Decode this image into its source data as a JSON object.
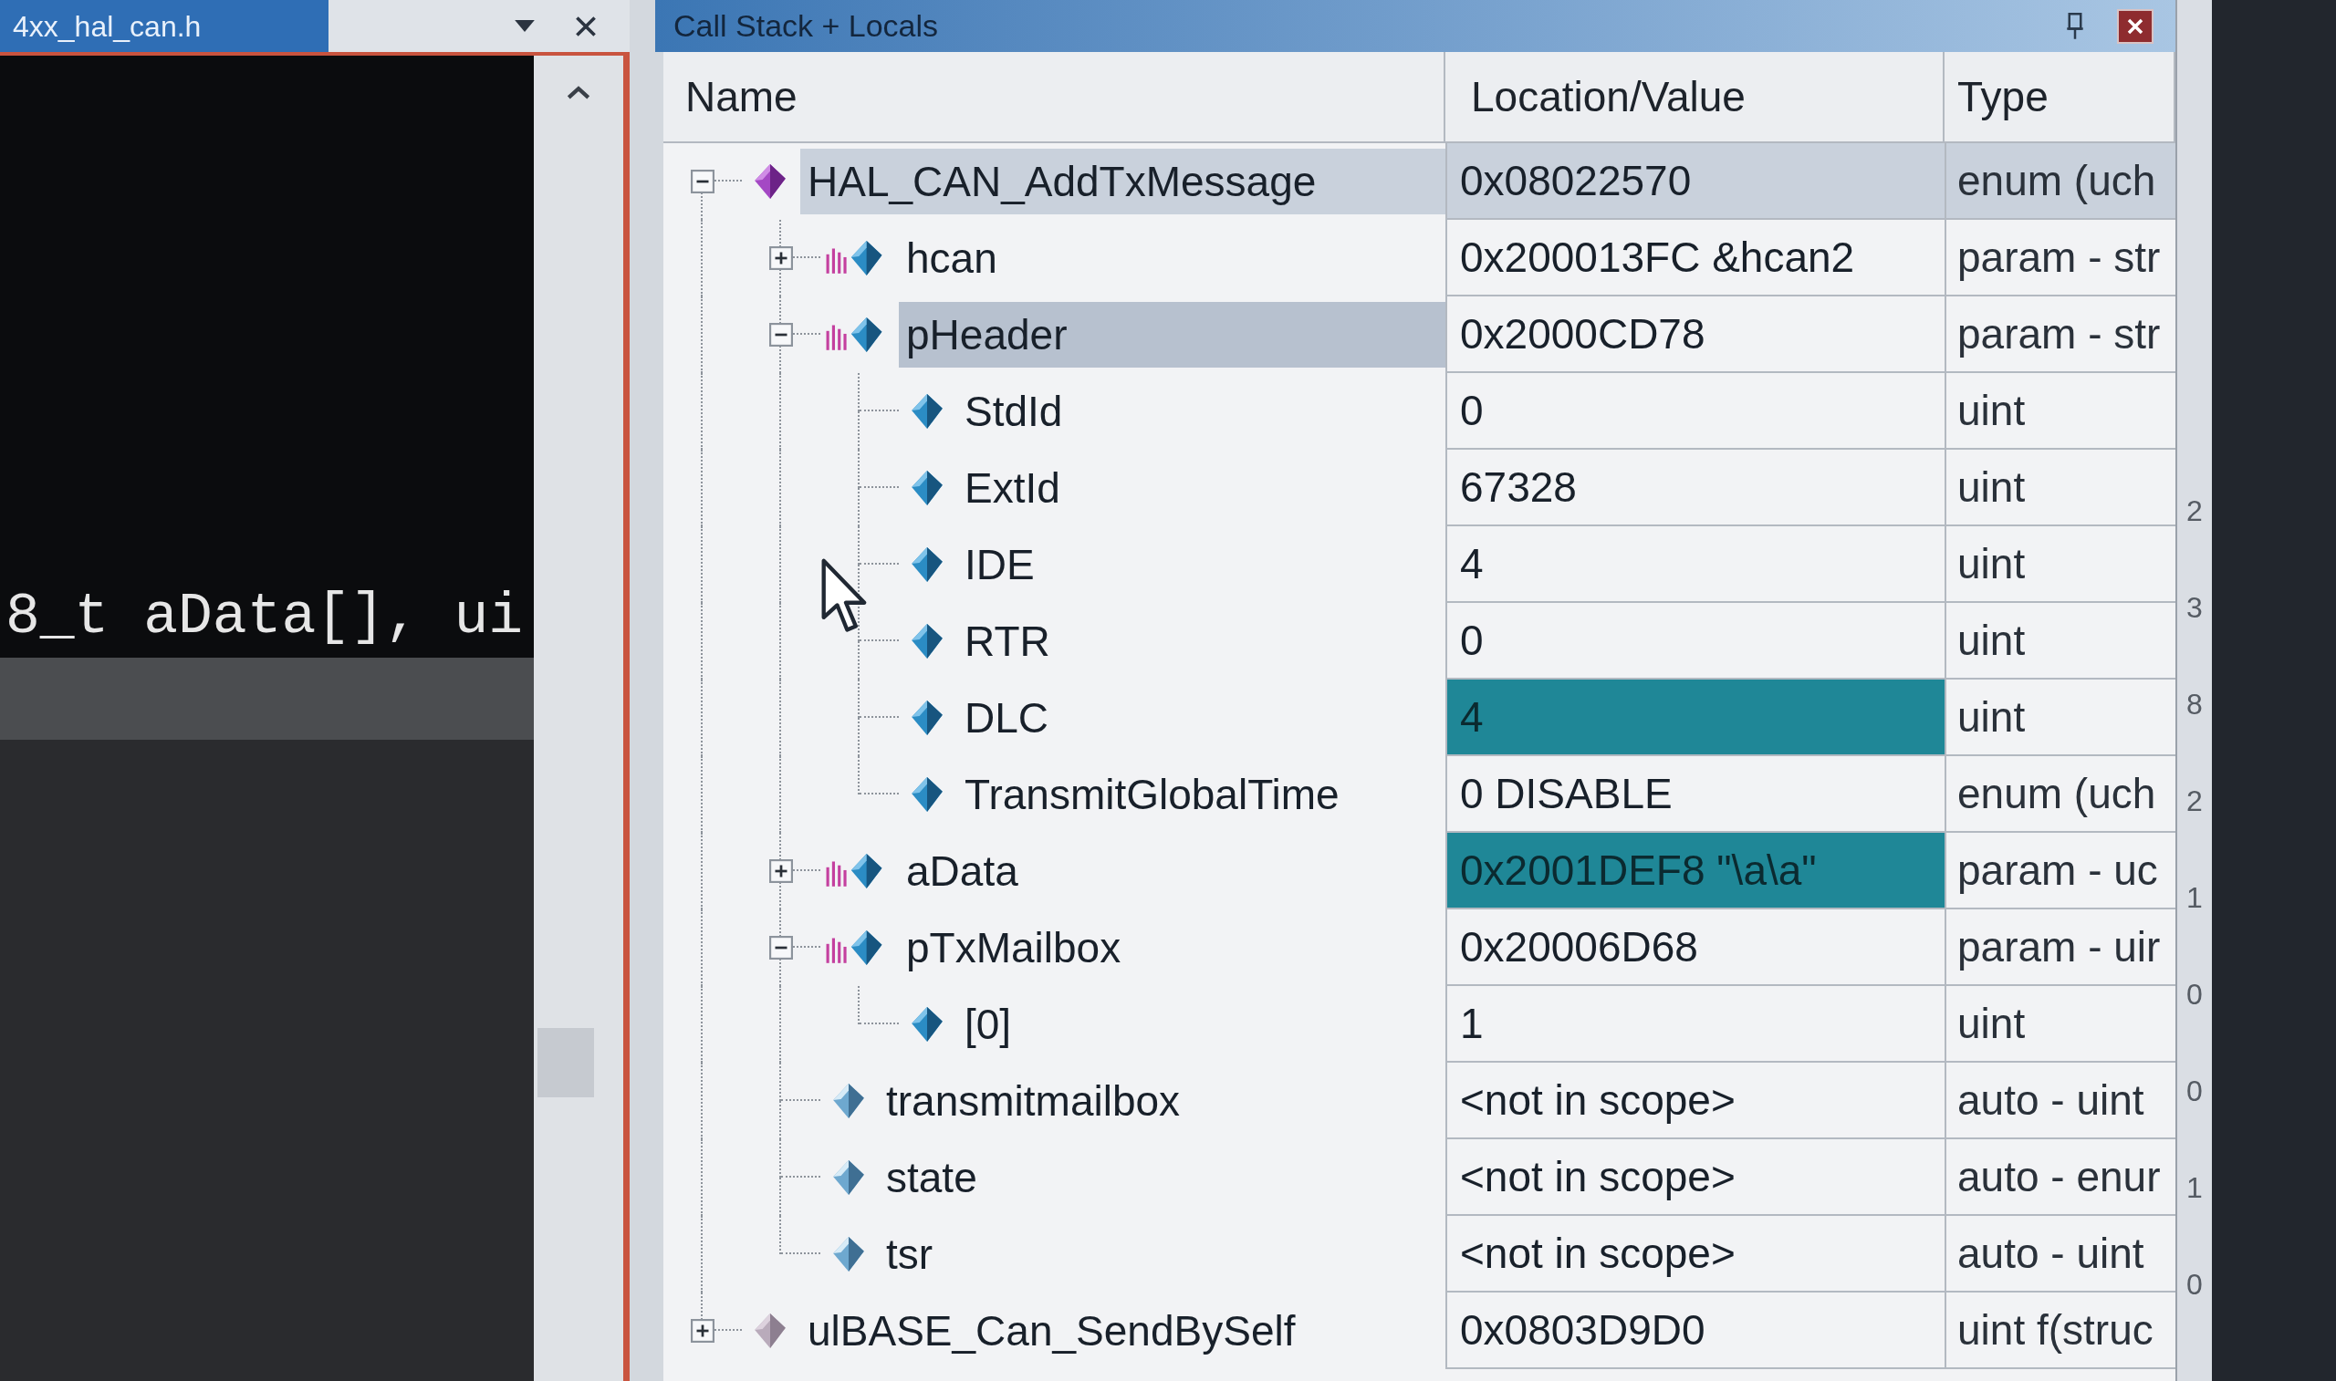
{
  "editor": {
    "tab": {
      "title": "4xx_hal_can.h",
      "selected": true
    },
    "code_line": "8_t aData[], ui"
  },
  "locals_window": {
    "title": "Call Stack + Locals",
    "columns": [
      "Name",
      "Location/Value",
      "Type"
    ],
    "tree": [
      {
        "name": "HAL_CAN_AddTxMessage",
        "value": "0x08022570",
        "type": "enum (uch",
        "kind": "function",
        "current": true,
        "selected": false,
        "changed": false,
        "expanded": true,
        "children": [
          {
            "name": "hcan",
            "value": "0x200013FC &hcan2",
            "type": "param - str",
            "kind": "param",
            "selected": false,
            "changed": false,
            "expanded": false
          },
          {
            "name": "pHeader",
            "value": "0x2000CD78",
            "type": "param - str",
            "kind": "param",
            "selected": true,
            "changed": false,
            "expanded": true,
            "children": [
              {
                "name": "StdId",
                "value": "0",
                "type": "uint",
                "kind": "member",
                "selected": false,
                "changed": false
              },
              {
                "name": "ExtId",
                "value": "67328",
                "type": "uint",
                "kind": "member",
                "selected": false,
                "changed": false
              },
              {
                "name": "IDE",
                "value": "4",
                "type": "uint",
                "kind": "member",
                "selected": false,
                "changed": false
              },
              {
                "name": "RTR",
                "value": "0",
                "type": "uint",
                "kind": "member",
                "selected": false,
                "changed": false
              },
              {
                "name": "DLC",
                "value": "4",
                "type": "uint",
                "kind": "member",
                "selected": false,
                "changed": true
              },
              {
                "name": "TransmitGlobalTime",
                "value": "0 DISABLE",
                "type": "enum (uch",
                "kind": "member",
                "selected": false,
                "changed": false
              }
            ]
          },
          {
            "name": "aData",
            "value": "0x2001DEF8 \"\\a\\a\"",
            "type": "param - uc",
            "kind": "param",
            "selected": false,
            "changed": true,
            "expanded": false
          },
          {
            "name": "pTxMailbox",
            "value": "0x20006D68",
            "type": "param - uir",
            "kind": "param",
            "selected": false,
            "changed": false,
            "expanded": true,
            "children": [
              {
                "name": "[0]",
                "value": "1",
                "type": "uint",
                "kind": "member",
                "selected": false,
                "changed": false
              }
            ]
          },
          {
            "name": "transmitmailbox",
            "value": "<not in scope>",
            "type": "auto - uint",
            "kind": "auto",
            "selected": false,
            "changed": false
          },
          {
            "name": "state",
            "value": "<not in scope>",
            "type": "auto - enur",
            "kind": "auto",
            "selected": false,
            "changed": false
          },
          {
            "name": "tsr",
            "value": "<not in scope>",
            "type": "auto - uint",
            "kind": "auto",
            "selected": false,
            "changed": false
          }
        ]
      },
      {
        "name": "ulBASE_Can_SendBySelf",
        "value": "0x0803D9D0",
        "type": "uint f(struc",
        "kind": "function",
        "current": false,
        "selected": false,
        "changed": false,
        "expanded": false
      }
    ]
  },
  "side_strip": {
    "digits": [
      "2",
      "3",
      "8",
      "2",
      "1",
      "0",
      "0",
      "1",
      "0"
    ]
  }
}
